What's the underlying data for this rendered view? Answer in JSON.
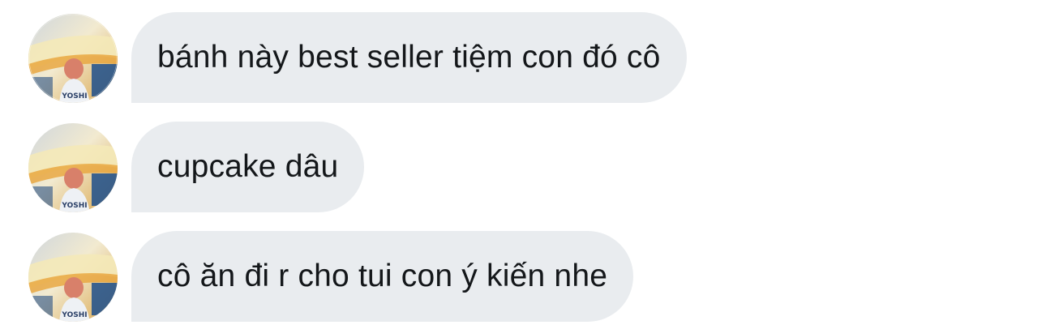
{
  "conversation": {
    "messages": [
      {
        "text": "bánh này best seller tiệm con đó cô",
        "avatar_icon": "user-avatar-icon"
      },
      {
        "text": "cupcake dâu",
        "avatar_icon": "user-avatar-icon"
      },
      {
        "text": "cô ăn đi r cho tui con ý kiến nhe",
        "avatar_icon": "user-avatar-icon"
      }
    ],
    "avatar_jersey_text": "YOSHI",
    "colors": {
      "bubble_background": "#e9ecef",
      "text": "#14171a",
      "page_background": "#ffffff"
    }
  }
}
